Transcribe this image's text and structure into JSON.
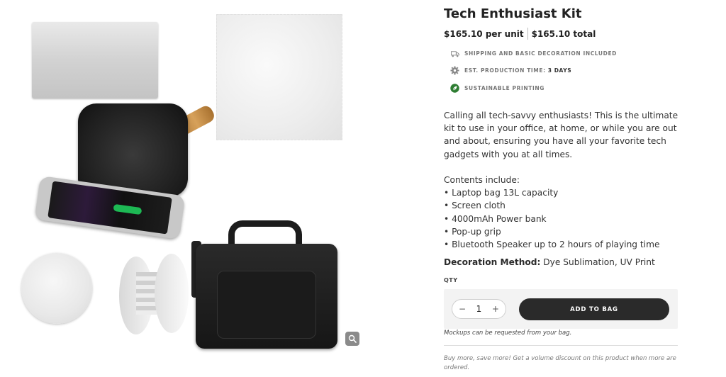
{
  "product": {
    "title": "Tech Enthusiast Kit",
    "price_unit": "$165.10 per unit",
    "price_total": "$165.10 total"
  },
  "features": [
    {
      "icon": "truck-icon",
      "label": "Shipping and basic decoration included",
      "value": ""
    },
    {
      "icon": "gear-icon",
      "label": "Est. production time:",
      "value": "3 days"
    },
    {
      "icon": "leaf-icon",
      "label": "Sustainable printing",
      "value": ""
    }
  ],
  "description": {
    "intro": "Calling all tech-savvy enthusiasts! This is the ultimate kit to use in your office, at home, or while you are out and about, ensuring you have all your favorite tech gadgets with you at all times.",
    "contents_heading": "Contents include:",
    "contents": [
      "• Laptop bag 13L capacity",
      "• Screen cloth",
      "• 4000mAh Power bank",
      "• Pop-up grip",
      "• Bluetooth Speaker up to 2 hours of playing time"
    ],
    "decoration_label": "Decoration Method:",
    "decoration_value": " Dye Sublimation, UV Print"
  },
  "cart": {
    "qty_label": "QTY",
    "qty_value": "1",
    "minus": "−",
    "plus": "+",
    "add_button": "ADD TO BAG",
    "mockup_note": "Mockups can be requested from your bag.",
    "volume_note": "Buy more, save more! Get a volume discount on this product when more are ordered."
  },
  "colors": {
    "button_bg": "#2a2a2a",
    "leaf_green": "#2e7d32"
  }
}
